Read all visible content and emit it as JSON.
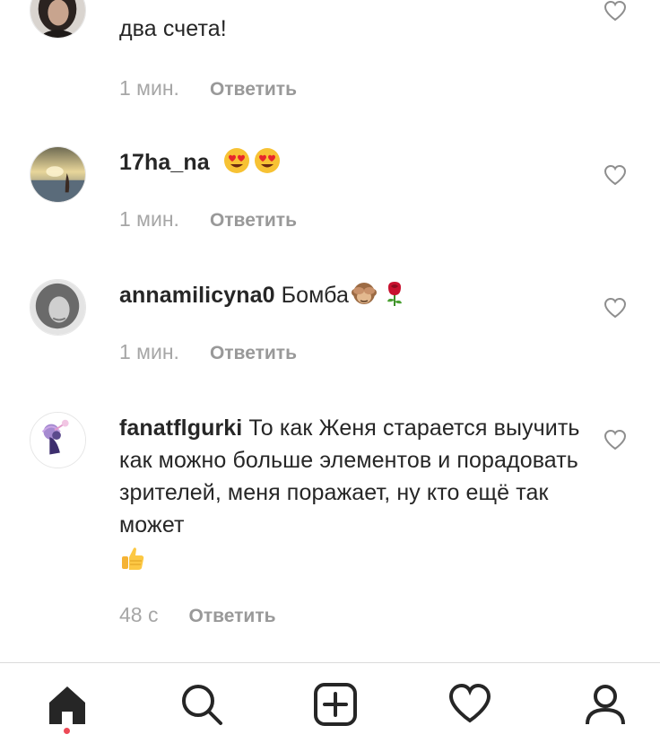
{
  "comments": [
    {
      "username": "",
      "text": "два счета!",
      "time": "1 мин.",
      "reply": "Ответить",
      "avatar": "avatar-dark-hair"
    },
    {
      "username": "17ha_na",
      "text": "",
      "emojis": [
        "heart-eyes-emoji",
        "heart-eyes-emoji"
      ],
      "time": "1 мин.",
      "reply": "Ответить",
      "avatar": "avatar-sunset"
    },
    {
      "username": "annamilicyna0",
      "text": "Бомба",
      "emojis": [
        "see-no-evil-monkey-emoji",
        "rose-emoji"
      ],
      "time": "1 мин.",
      "reply": "Ответить",
      "avatar": "avatar-curly-hair"
    },
    {
      "username": "fanatflgurki",
      "text": "То как Женя старается выучить как можно больше элементов и порадовать зрителей, меня поражает, ну кто ещё так может",
      "emojis": [
        "thumbs-up-emoji"
      ],
      "time": "48 с",
      "reply": "Ответить",
      "avatar": "avatar-anime-umbrella"
    }
  ],
  "tabbar": {
    "items": [
      "home-icon",
      "search-icon",
      "new-post-icon",
      "activity-heart-icon",
      "profile-icon"
    ],
    "active": "home-icon",
    "notification_dot_color": "#ed4956"
  },
  "colors": {
    "text": "#262626",
    "meta": "#999999",
    "divider": "#dbdbdb"
  }
}
